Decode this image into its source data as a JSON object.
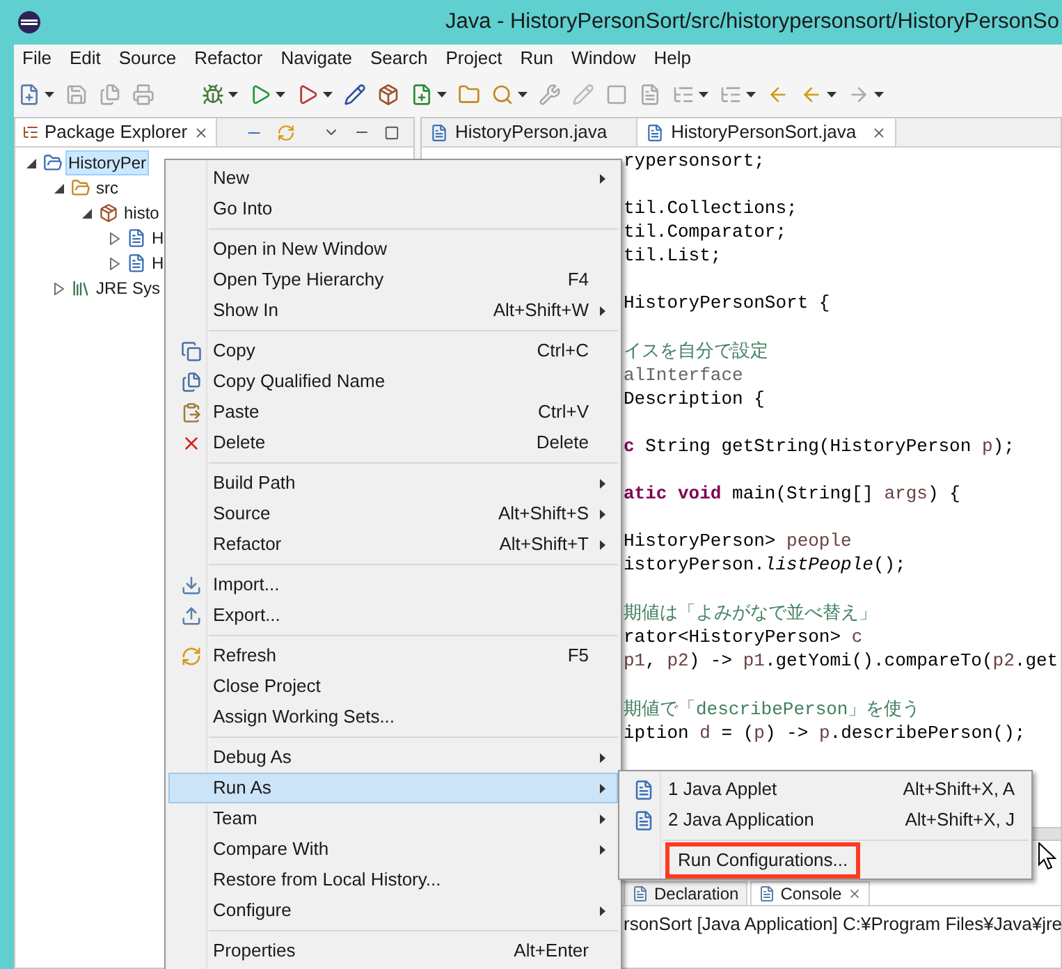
{
  "window": {
    "title": "Java - HistoryPersonSort/src/historypersonsort/HistoryPersonSo"
  },
  "menu_bar": [
    "File",
    "Edit",
    "Source",
    "Refactor",
    "Navigate",
    "Search",
    "Project",
    "Run",
    "Window",
    "Help"
  ],
  "package_explorer": {
    "title": "Package Explorer",
    "tree": [
      {
        "label": "HistoryPer",
        "kind": "project",
        "expanded": true,
        "selected": true,
        "children": [
          {
            "label": "src",
            "kind": "source-folder",
            "expanded": true,
            "selected": false,
            "children": [
              {
                "label": "histo",
                "kind": "package",
                "expanded": true,
                "selected": false,
                "children": [
                  {
                    "label": "H",
                    "kind": "java-file",
                    "expanded": false,
                    "selected": false
                  },
                  {
                    "label": "H",
                    "kind": "java-file",
                    "expanded": false,
                    "selected": false
                  }
                ]
              }
            ]
          },
          {
            "label": "JRE Sys",
            "kind": "library",
            "expanded": false,
            "selected": false
          }
        ]
      }
    ]
  },
  "editor": {
    "tabs": [
      {
        "label": "HistoryPerson.java",
        "selected": false
      },
      {
        "label": "HistoryPersonSort.java",
        "selected": true
      }
    ],
    "code_blocks": [
      [
        [
          {
            "kind": "plain",
            "text": "rypersonsort;"
          }
        ]
      ],
      [
        [
          {
            "kind": "plain",
            "text": "til.Collections;"
          }
        ],
        [
          {
            "kind": "plain",
            "text": "til.Comparator;"
          }
        ],
        [
          {
            "kind": "plain",
            "text": "til.List;"
          }
        ]
      ],
      [
        [
          {
            "kind": "plain",
            "text": "HistoryPersonSort {"
          }
        ]
      ],
      [
        [
          {
            "kind": "comment",
            "text": "イスを自分で設定"
          }
        ],
        [
          {
            "kind": "annotation",
            "text": "alInterface"
          }
        ],
        [
          {
            "kind": "plain",
            "text": " Description {"
          }
        ]
      ],
      [
        [
          {
            "kind": "keyword",
            "text": "c"
          },
          {
            "kind": "plain",
            "text": " String getString(HistoryPerson "
          },
          {
            "kind": "variable",
            "text": "p"
          },
          {
            "kind": "plain",
            "text": ");"
          }
        ]
      ],
      [
        [
          {
            "kind": "keyword",
            "text": "atic void"
          },
          {
            "kind": "plain",
            "text": " main(String[] "
          },
          {
            "kind": "variable",
            "text": "args"
          },
          {
            "kind": "plain",
            "text": ") {"
          }
        ]
      ],
      [
        [
          {
            "kind": "plain",
            "text": "HistoryPerson> "
          },
          {
            "kind": "variable",
            "text": "people"
          }
        ],
        [
          {
            "kind": "plain",
            "text": "istoryPerson."
          },
          {
            "kind": "static",
            "text": "listPeople"
          },
          {
            "kind": "plain",
            "text": "();"
          }
        ]
      ],
      [
        [
          {
            "kind": "comment",
            "text": "期値は「よみがなで並べ替え」"
          }
        ],
        [
          {
            "kind": "plain",
            "text": "rator<HistoryPerson> "
          },
          {
            "kind": "variable",
            "text": "c"
          }
        ],
        [
          {
            "kind": "variable",
            "text": "p1"
          },
          {
            "kind": "plain",
            "text": ", "
          },
          {
            "kind": "variable",
            "text": "p2"
          },
          {
            "kind": "plain",
            "text": ") -> "
          },
          {
            "kind": "variable",
            "text": "p1"
          },
          {
            "kind": "plain",
            "text": ".getYomi().compareTo("
          },
          {
            "kind": "variable",
            "text": "p2"
          },
          {
            "kind": "plain",
            "text": ".get"
          }
        ]
      ],
      [
        [
          {
            "kind": "comment",
            "text": "期値で「"
          },
          {
            "kind": "comment-code",
            "text": "describePerson"
          },
          {
            "kind": "comment",
            "text": "」を使う"
          }
        ],
        [
          {
            "kind": "plain",
            "text": "iption "
          },
          {
            "kind": "variable",
            "text": "d"
          },
          {
            "kind": "plain",
            "text": " = ("
          },
          {
            "kind": "variable",
            "text": "p"
          },
          {
            "kind": "plain",
            "text": ") -> "
          },
          {
            "kind": "variable",
            "text": "p"
          },
          {
            "kind": "plain",
            "text": ".describePerson();"
          }
        ]
      ]
    ]
  },
  "bottom_panel": {
    "tabs": [
      {
        "label": "Declaration",
        "selected": false
      },
      {
        "label": "Console",
        "selected": true
      }
    ],
    "console_line": "rsonSort [Java Application] C:¥Program Files¥Java¥jre"
  },
  "context_menu": {
    "groups": [
      [
        {
          "label": "New",
          "submenu": true,
          "selected": false
        },
        {
          "label": "Go Into",
          "submenu": false,
          "selected": false
        }
      ],
      [
        {
          "label": "Open in New Window",
          "submenu": false,
          "selected": false
        },
        {
          "label": "Open Type Hierarchy",
          "shortcut": "F4",
          "submenu": false,
          "selected": false
        },
        {
          "label": "Show In",
          "shortcut": "Alt+Shift+W",
          "submenu": true,
          "selected": false
        }
      ],
      [
        {
          "label": "Copy",
          "shortcut": "Ctrl+C",
          "submenu": false,
          "selected": false
        },
        {
          "label": "Copy Qualified Name",
          "submenu": false,
          "selected": false
        },
        {
          "label": "Paste",
          "shortcut": "Ctrl+V",
          "submenu": false,
          "selected": false
        },
        {
          "label": "Delete",
          "shortcut": "Delete",
          "submenu": false,
          "selected": false
        }
      ],
      [
        {
          "label": "Build Path",
          "submenu": true,
          "selected": false
        },
        {
          "label": "Source",
          "shortcut": "Alt+Shift+S",
          "submenu": true,
          "selected": false
        },
        {
          "label": "Refactor",
          "shortcut": "Alt+Shift+T",
          "submenu": true,
          "selected": false
        }
      ],
      [
        {
          "label": "Import...",
          "submenu": false,
          "selected": false
        },
        {
          "label": "Export...",
          "submenu": false,
          "selected": false
        }
      ],
      [
        {
          "label": "Refresh",
          "shortcut": "F5",
          "submenu": false,
          "selected": false
        },
        {
          "label": "Close Project",
          "submenu": false,
          "selected": false
        },
        {
          "label": "Assign Working Sets...",
          "submenu": false,
          "selected": false
        }
      ],
      [
        {
          "label": "Debug As",
          "submenu": true,
          "selected": false
        },
        {
          "label": "Run As",
          "submenu": true,
          "selected": true
        },
        {
          "label": "Team",
          "submenu": true,
          "selected": false
        },
        {
          "label": "Compare With",
          "submenu": true,
          "selected": false
        },
        {
          "label": "Restore from Local History...",
          "submenu": false,
          "selected": false
        },
        {
          "label": "Configure",
          "submenu": true,
          "selected": false
        }
      ],
      [
        {
          "label": "Properties",
          "shortcut": "Alt+Enter",
          "submenu": false,
          "selected": false
        }
      ]
    ]
  },
  "submenu": {
    "groups": [
      [
        {
          "label": "1 Java Applet",
          "shortcut": "Alt+Shift+X, A",
          "highlighted": false
        },
        {
          "label": "2 Java Application",
          "shortcut": "Alt+Shift+X, J",
          "highlighted": false
        }
      ],
      [
        {
          "label": "Run Configurations...",
          "highlighted": true
        }
      ]
    ]
  }
}
